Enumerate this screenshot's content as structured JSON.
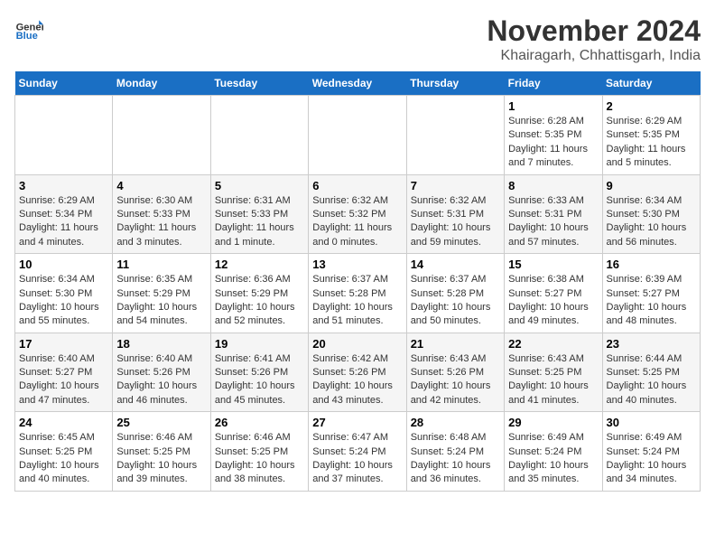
{
  "header": {
    "logo_general": "General",
    "logo_blue": "Blue",
    "title": "November 2024",
    "subtitle": "Khairagarh, Chhattisgarh, India"
  },
  "days_of_week": [
    "Sunday",
    "Monday",
    "Tuesday",
    "Wednesday",
    "Thursday",
    "Friday",
    "Saturday"
  ],
  "weeks": [
    [
      {
        "day": "",
        "content": ""
      },
      {
        "day": "",
        "content": ""
      },
      {
        "day": "",
        "content": ""
      },
      {
        "day": "",
        "content": ""
      },
      {
        "day": "",
        "content": ""
      },
      {
        "day": "1",
        "content": "Sunrise: 6:28 AM\nSunset: 5:35 PM\nDaylight: 11 hours and 7 minutes."
      },
      {
        "day": "2",
        "content": "Sunrise: 6:29 AM\nSunset: 5:35 PM\nDaylight: 11 hours and 5 minutes."
      }
    ],
    [
      {
        "day": "3",
        "content": "Sunrise: 6:29 AM\nSunset: 5:34 PM\nDaylight: 11 hours and 4 minutes."
      },
      {
        "day": "4",
        "content": "Sunrise: 6:30 AM\nSunset: 5:33 PM\nDaylight: 11 hours and 3 minutes."
      },
      {
        "day": "5",
        "content": "Sunrise: 6:31 AM\nSunset: 5:33 PM\nDaylight: 11 hours and 1 minute."
      },
      {
        "day": "6",
        "content": "Sunrise: 6:32 AM\nSunset: 5:32 PM\nDaylight: 11 hours and 0 minutes."
      },
      {
        "day": "7",
        "content": "Sunrise: 6:32 AM\nSunset: 5:31 PM\nDaylight: 10 hours and 59 minutes."
      },
      {
        "day": "8",
        "content": "Sunrise: 6:33 AM\nSunset: 5:31 PM\nDaylight: 10 hours and 57 minutes."
      },
      {
        "day": "9",
        "content": "Sunrise: 6:34 AM\nSunset: 5:30 PM\nDaylight: 10 hours and 56 minutes."
      }
    ],
    [
      {
        "day": "10",
        "content": "Sunrise: 6:34 AM\nSunset: 5:30 PM\nDaylight: 10 hours and 55 minutes."
      },
      {
        "day": "11",
        "content": "Sunrise: 6:35 AM\nSunset: 5:29 PM\nDaylight: 10 hours and 54 minutes."
      },
      {
        "day": "12",
        "content": "Sunrise: 6:36 AM\nSunset: 5:29 PM\nDaylight: 10 hours and 52 minutes."
      },
      {
        "day": "13",
        "content": "Sunrise: 6:37 AM\nSunset: 5:28 PM\nDaylight: 10 hours and 51 minutes."
      },
      {
        "day": "14",
        "content": "Sunrise: 6:37 AM\nSunset: 5:28 PM\nDaylight: 10 hours and 50 minutes."
      },
      {
        "day": "15",
        "content": "Sunrise: 6:38 AM\nSunset: 5:27 PM\nDaylight: 10 hours and 49 minutes."
      },
      {
        "day": "16",
        "content": "Sunrise: 6:39 AM\nSunset: 5:27 PM\nDaylight: 10 hours and 48 minutes."
      }
    ],
    [
      {
        "day": "17",
        "content": "Sunrise: 6:40 AM\nSunset: 5:27 PM\nDaylight: 10 hours and 47 minutes."
      },
      {
        "day": "18",
        "content": "Sunrise: 6:40 AM\nSunset: 5:26 PM\nDaylight: 10 hours and 46 minutes."
      },
      {
        "day": "19",
        "content": "Sunrise: 6:41 AM\nSunset: 5:26 PM\nDaylight: 10 hours and 45 minutes."
      },
      {
        "day": "20",
        "content": "Sunrise: 6:42 AM\nSunset: 5:26 PM\nDaylight: 10 hours and 43 minutes."
      },
      {
        "day": "21",
        "content": "Sunrise: 6:43 AM\nSunset: 5:26 PM\nDaylight: 10 hours and 42 minutes."
      },
      {
        "day": "22",
        "content": "Sunrise: 6:43 AM\nSunset: 5:25 PM\nDaylight: 10 hours and 41 minutes."
      },
      {
        "day": "23",
        "content": "Sunrise: 6:44 AM\nSunset: 5:25 PM\nDaylight: 10 hours and 40 minutes."
      }
    ],
    [
      {
        "day": "24",
        "content": "Sunrise: 6:45 AM\nSunset: 5:25 PM\nDaylight: 10 hours and 40 minutes."
      },
      {
        "day": "25",
        "content": "Sunrise: 6:46 AM\nSunset: 5:25 PM\nDaylight: 10 hours and 39 minutes."
      },
      {
        "day": "26",
        "content": "Sunrise: 6:46 AM\nSunset: 5:25 PM\nDaylight: 10 hours and 38 minutes."
      },
      {
        "day": "27",
        "content": "Sunrise: 6:47 AM\nSunset: 5:24 PM\nDaylight: 10 hours and 37 minutes."
      },
      {
        "day": "28",
        "content": "Sunrise: 6:48 AM\nSunset: 5:24 PM\nDaylight: 10 hours and 36 minutes."
      },
      {
        "day": "29",
        "content": "Sunrise: 6:49 AM\nSunset: 5:24 PM\nDaylight: 10 hours and 35 minutes."
      },
      {
        "day": "30",
        "content": "Sunrise: 6:49 AM\nSunset: 5:24 PM\nDaylight: 10 hours and 34 minutes."
      }
    ]
  ]
}
